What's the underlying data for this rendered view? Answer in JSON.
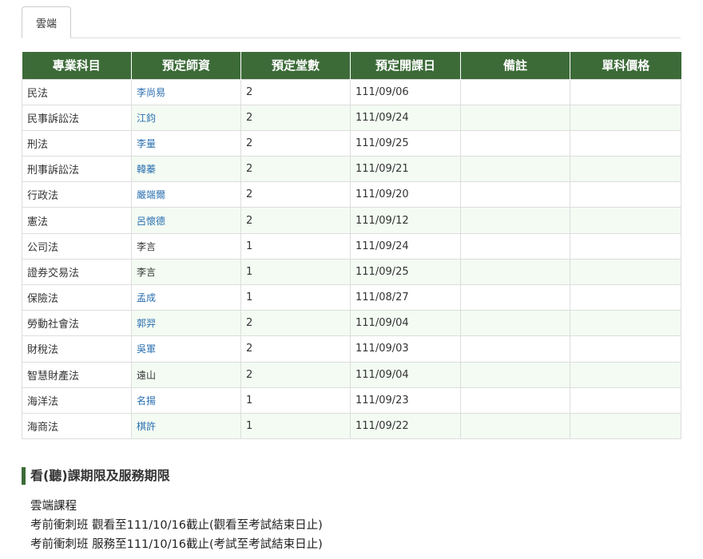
{
  "tabs": [
    {
      "label": "雲端"
    }
  ],
  "table": {
    "headers": [
      "專業科目",
      "預定師資",
      "預定堂數",
      "預定開課日",
      "備註",
      "單科價格"
    ],
    "rows": [
      {
        "subject": "民法",
        "teacher": "李尚易",
        "teacher_link": true,
        "sessions": "2",
        "date": "111/09/06",
        "note": "",
        "price": ""
      },
      {
        "subject": "民事訴訟法",
        "teacher": "江鈞",
        "teacher_link": true,
        "sessions": "2",
        "date": "111/09/24",
        "note": "",
        "price": ""
      },
      {
        "subject": "刑法",
        "teacher": "李量",
        "teacher_link": true,
        "sessions": "2",
        "date": "111/09/25",
        "note": "",
        "price": ""
      },
      {
        "subject": "刑事訴訟法",
        "teacher": "韓蓁",
        "teacher_link": true,
        "sessions": "2",
        "date": "111/09/21",
        "note": "",
        "price": ""
      },
      {
        "subject": "行政法",
        "teacher": "嚴端爾",
        "teacher_link": true,
        "sessions": "2",
        "date": "111/09/20",
        "note": "",
        "price": ""
      },
      {
        "subject": "憲法",
        "teacher": "呂懷德",
        "teacher_link": true,
        "sessions": "2",
        "date": "111/09/12",
        "note": "",
        "price": ""
      },
      {
        "subject": "公司法",
        "teacher": "李言",
        "teacher_link": false,
        "sessions": "1",
        "date": "111/09/24",
        "note": "",
        "price": ""
      },
      {
        "subject": "證券交易法",
        "teacher": "李言",
        "teacher_link": false,
        "sessions": "1",
        "date": "111/09/25",
        "note": "",
        "price": ""
      },
      {
        "subject": "保險法",
        "teacher": "孟成",
        "teacher_link": true,
        "sessions": "1",
        "date": "111/08/27",
        "note": "",
        "price": ""
      },
      {
        "subject": "勞動社會法",
        "teacher": "郭羿",
        "teacher_link": true,
        "sessions": "2",
        "date": "111/09/04",
        "note": "",
        "price": ""
      },
      {
        "subject": "財稅法",
        "teacher": "吳軍",
        "teacher_link": true,
        "sessions": "2",
        "date": "111/09/03",
        "note": "",
        "price": ""
      },
      {
        "subject": "智慧財產法",
        "teacher": "遠山",
        "teacher_link": false,
        "sessions": "2",
        "date": "111/09/04",
        "note": "",
        "price": ""
      },
      {
        "subject": "海洋法",
        "teacher": "名揚",
        "teacher_link": true,
        "sessions": "1",
        "date": "111/09/23",
        "note": "",
        "price": ""
      },
      {
        "subject": "海商法",
        "teacher": "棋許",
        "teacher_link": true,
        "sessions": "1",
        "date": "111/09/22",
        "note": "",
        "price": ""
      }
    ]
  },
  "period_section": {
    "title": "看(聽)課期限及服務期限",
    "lines": [
      "雲端課程",
      "考前衝刺班 觀看至111/10/16截止(觀看至考試結束日止)",
      "考前衝刺班 服務至111/10/16截止(考試至考試結束日止)"
    ]
  },
  "colors": {
    "header_green": "#3c6b38",
    "link_blue": "#2a6fb0",
    "row_alt": "#f3fbf3"
  }
}
